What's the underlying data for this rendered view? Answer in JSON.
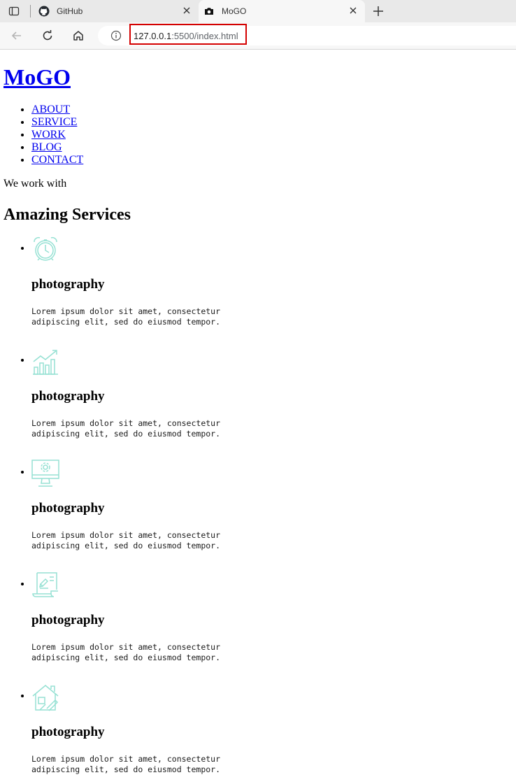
{
  "browser": {
    "tabs": [
      {
        "title": "GitHub",
        "favicon": "github-icon",
        "active": false
      },
      {
        "title": "MoGO",
        "favicon": "camera-icon",
        "active": true
      }
    ],
    "url": {
      "host": "127.0.0.1",
      "rest": ":5500/index.html"
    }
  },
  "header": {
    "logo": "MoGO",
    "nav": [
      "ABOUT",
      "SERVICE",
      "WORK",
      "BLOG",
      "CONTACT"
    ]
  },
  "services": {
    "tagline": "We work with",
    "title": "Amazing Services",
    "items": [
      {
        "icon": "alarm-clock-icon",
        "title": "photography",
        "text": "Lorem ipsum dolor sit amet, consectetur adipiscing elit, sed do eiusmod tempor."
      },
      {
        "icon": "growth-chart-icon",
        "title": "photography",
        "text": "Lorem ipsum dolor sit amet, consectetur adipiscing elit, sed do eiusmod tempor."
      },
      {
        "icon": "monitor-gear-icon",
        "title": "photography",
        "text": "Lorem ipsum dolor sit amet, consectetur adipiscing elit, sed do eiusmod tempor."
      },
      {
        "icon": "scroll-document-icon",
        "title": "photography",
        "text": "Lorem ipsum dolor sit amet, consectetur adipiscing elit, sed do eiusmod tempor."
      },
      {
        "icon": "house-design-icon",
        "title": "photography",
        "text": "Lorem ipsum dolor sit amet, consectetur adipiscing elit, sed do eiusmod tempor."
      }
    ]
  },
  "colors": {
    "icon": "#95e1d3",
    "link": "#0000ee",
    "highlight": "#d40000"
  }
}
